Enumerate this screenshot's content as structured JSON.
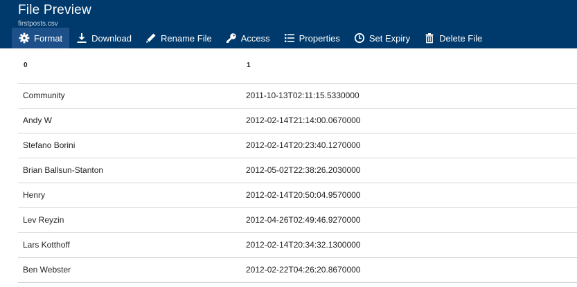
{
  "header": {
    "title": "File Preview",
    "filename": "firstposts.csv"
  },
  "toolbar": {
    "items": [
      {
        "label": "Format",
        "icon": "gear-icon",
        "active": true
      },
      {
        "label": "Download",
        "icon": "download-icon"
      },
      {
        "label": "Rename File",
        "icon": "pencil-icon"
      },
      {
        "label": "Access",
        "icon": "key-icon"
      },
      {
        "label": "Properties",
        "icon": "list-icon"
      },
      {
        "label": "Set Expiry",
        "icon": "clock-icon"
      },
      {
        "label": "Delete File",
        "icon": "trash-icon"
      }
    ]
  },
  "table": {
    "columns": [
      "0",
      "1"
    ],
    "rows": [
      [
        "Community",
        "2011-10-13T02:11:15.5330000"
      ],
      [
        "Andy W",
        "2012-02-14T21:14:00.0670000"
      ],
      [
        "Stefano Borini",
        "2012-02-14T20:23:40.1270000"
      ],
      [
        "Brian Ballsun-Stanton",
        "2012-05-02T22:38:26.2030000"
      ],
      [
        "Henry",
        "2012-02-14T20:50:04.9570000"
      ],
      [
        "Lev Reyzin",
        "2012-04-26T02:49:46.9270000"
      ],
      [
        "Lars Kotthoff",
        "2012-02-14T20:34:32.1300000"
      ],
      [
        "Ben Webster",
        "2012-02-22T04:26:20.8670000"
      ]
    ]
  },
  "colors": {
    "header_bg": "#003a6c",
    "active_tab_bg": "#1d5089",
    "row_border": "#d5d5d5"
  }
}
